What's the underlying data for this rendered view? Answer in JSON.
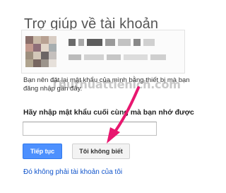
{
  "page": {
    "title": "Trợ giúp về tài khoản"
  },
  "watermark": {
    "text": "Thuthuattienich.com"
  },
  "info": {
    "text": "Bạn nên đặt lại mật khẩu của mình bằng thiết bị mà bạn đăng nhập gần đây."
  },
  "form": {
    "prompt_label": "Hãy nhập mật khẩu cuối cùng mà bạn nhớ được",
    "password_value": "",
    "next_button_label": "Tiếp tục",
    "dont_know_button_label": "Tôi không biết",
    "other_account_link": "Đó không phải tài khoản của tôi"
  },
  "colors": {
    "primary_button": "#4d90fe",
    "link": "#1155cc",
    "annotation_arrow": "#e8176f",
    "title": "#555555"
  },
  "icons": {
    "annotation": "pointer-arrow-icon"
  }
}
